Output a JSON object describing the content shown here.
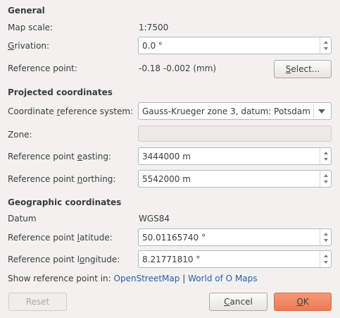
{
  "general": {
    "heading": "General",
    "map_scale_label": "Map scale:",
    "map_scale_value": "1:7500",
    "grivation_label_u": "G",
    "grivation_label_rest": "rivation:",
    "grivation_value": "0.0 °",
    "reference_point_label": "Reference point:",
    "reference_point_value": "-0.18 -0.002 (mm)",
    "select_button_u": "S",
    "select_button_rest": "elect..."
  },
  "projected": {
    "heading": "Projected coordinates",
    "crs_label_pre": "Coordinate ",
    "crs_label_u": "r",
    "crs_label_rest": "eference system:",
    "crs_value": "Gauss-Krueger zone 3, datum: Potsdam",
    "zone_label": "Zone:",
    "zone_value": "",
    "easting_label_pre": "Reference point ",
    "easting_label_u": "e",
    "easting_label_rest": "asting:",
    "easting_value": "3444000 m",
    "northing_label_pre": "Reference point ",
    "northing_label_u": "n",
    "northing_label_rest": "orthing:",
    "northing_value": "5542000 m"
  },
  "geographic": {
    "heading": "Geographic coordinates",
    "datum_label": "Datum",
    "datum_value": "WGS84",
    "latitude_label_pre": "Reference point ",
    "latitude_label_u": "l",
    "latitude_label_rest": "atitude:",
    "latitude_value": "50.01165740 °",
    "longitude_label_pre": "Reference point l",
    "longitude_label_u": "o",
    "longitude_label_rest": "ngitude:",
    "longitude_value": "8.21771810 °",
    "show_in_label": "Show reference point in:",
    "link_osm": "OpenStreetMap",
    "link_separator": "|",
    "link_woom": "World of O Maps"
  },
  "buttons": {
    "reset": "Reset",
    "cancel_u": "C",
    "cancel_rest": "ancel",
    "ok_u": "O",
    "ok_rest": "K"
  },
  "colors": {
    "background": "#f2f1f0",
    "link": "#2a5cab",
    "ok_button": "#ec7a52"
  }
}
